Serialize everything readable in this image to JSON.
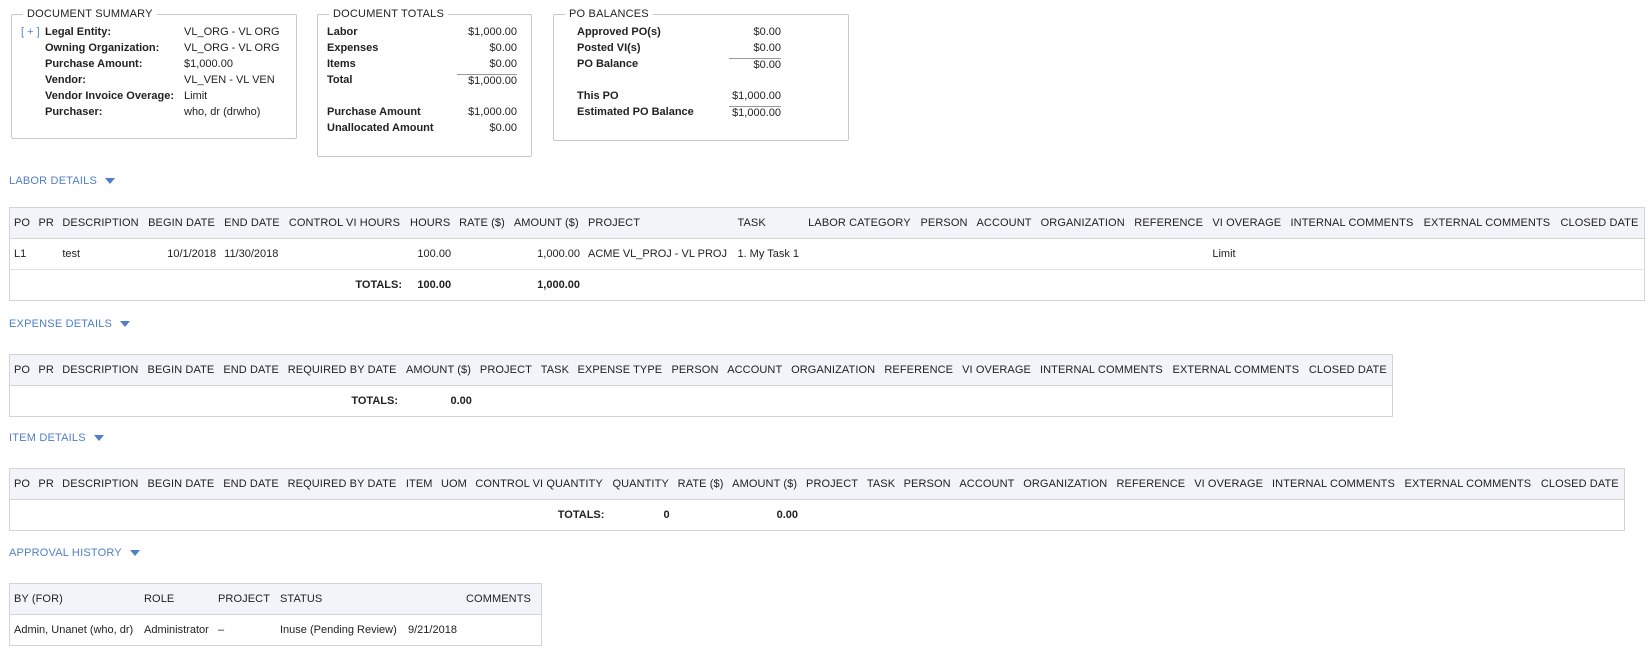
{
  "summary": {
    "legend": "DOCUMENT SUMMARY",
    "expander": "[ + ]",
    "rows": [
      {
        "label": "Legal Entity:",
        "value": "VL_ORG - VL ORG"
      },
      {
        "label": "Owning Organization:",
        "value": "VL_ORG - VL ORG"
      },
      {
        "label": "Purchase Amount:",
        "value": "$1,000.00"
      },
      {
        "label": "Vendor:",
        "value": "VL_VEN - VL VEN"
      },
      {
        "label": "Vendor Invoice Overage:",
        "value": "Limit"
      },
      {
        "label": "Purchaser:",
        "value": "who, dr (drwho)"
      }
    ]
  },
  "totals": {
    "legend": "DOCUMENT TOTALS",
    "rows": [
      {
        "label": "Labor",
        "value": "$1,000.00"
      },
      {
        "label": "Expenses",
        "value": "$0.00"
      },
      {
        "label": "Items",
        "value": "$0.00"
      },
      {
        "label": "Total",
        "value": "$1,000.00"
      },
      {
        "label": "Purchase Amount",
        "value": "$1,000.00"
      },
      {
        "label": "Unallocated Amount",
        "value": "$0.00"
      }
    ]
  },
  "po_balances": {
    "legend": "PO BALANCES",
    "rows": [
      {
        "label": "Approved PO(s)",
        "value": "$0.00"
      },
      {
        "label": "Posted VI(s)",
        "value": "$0.00"
      },
      {
        "label": "PO Balance",
        "value": "$0.00"
      },
      {
        "label": "This PO",
        "value": "$1,000.00"
      },
      {
        "label": "Estimated PO Balance",
        "value": "$1,000.00"
      }
    ]
  },
  "labor": {
    "title": "LABOR DETAILS",
    "columns": [
      "PO",
      "PR",
      "DESCRIPTION",
      "BEGIN DATE",
      "END DATE",
      "CONTROL VI HOURS",
      "HOURS",
      "RATE ($)",
      "AMOUNT ($)",
      "PROJECT",
      "TASK",
      "LABOR CATEGORY",
      "PERSON",
      "ACCOUNT",
      "ORGANIZATION",
      "REFERENCE",
      "VI OVERAGE",
      "INTERNAL COMMENTS",
      "EXTERNAL COMMENTS",
      "CLOSED DATE"
    ],
    "row": {
      "po": "L1",
      "pr": "",
      "description": "test",
      "begin_date": "10/1/2018",
      "end_date": "11/30/2018",
      "control_vi_hours": "",
      "hours": "100.00",
      "rate": "",
      "amount": "1,000.00",
      "project": "ACME VL_PROJ - VL PROJ",
      "task": "1. My Task 1",
      "vi_overage": "Limit"
    },
    "totals": {
      "label": "TOTALS:",
      "hours": "100.00",
      "amount": "1,000.00"
    }
  },
  "expense": {
    "title": "EXPENSE DETAILS",
    "columns": [
      "PO",
      "PR",
      "DESCRIPTION",
      "BEGIN DATE",
      "END DATE",
      "REQUIRED BY DATE",
      "AMOUNT ($)",
      "PROJECT",
      "TASK",
      "EXPENSE TYPE",
      "PERSON",
      "ACCOUNT",
      "ORGANIZATION",
      "REFERENCE",
      "VI OVERAGE",
      "INTERNAL COMMENTS",
      "EXTERNAL COMMENTS",
      "CLOSED DATE"
    ],
    "totals": {
      "label": "TOTALS:",
      "amount": "0.00"
    }
  },
  "item": {
    "title": "ITEM DETAILS",
    "columns": [
      "PO",
      "PR",
      "DESCRIPTION",
      "BEGIN DATE",
      "END DATE",
      "REQUIRED BY DATE",
      "ITEM",
      "UOM",
      "CONTROL VI QUANTITY",
      "QUANTITY",
      "RATE ($)",
      "AMOUNT ($)",
      "PROJECT",
      "TASK",
      "PERSON",
      "ACCOUNT",
      "ORGANIZATION",
      "REFERENCE",
      "VI OVERAGE",
      "INTERNAL COMMENTS",
      "EXTERNAL COMMENTS",
      "CLOSED DATE"
    ],
    "totals": {
      "label": "TOTALS:",
      "quantity": "0",
      "amount": "0.00"
    }
  },
  "approval": {
    "title": "APPROVAL HISTORY",
    "columns": [
      "BY (FOR)",
      "ROLE",
      "PROJECT",
      "STATUS",
      "",
      "COMMENTS"
    ],
    "row": {
      "by": "Admin, Unanet (who, dr)",
      "role": "Administrator",
      "project": "–",
      "status": "Inuse (Pending Review)",
      "date": "9/21/2018",
      "comments": ""
    }
  }
}
